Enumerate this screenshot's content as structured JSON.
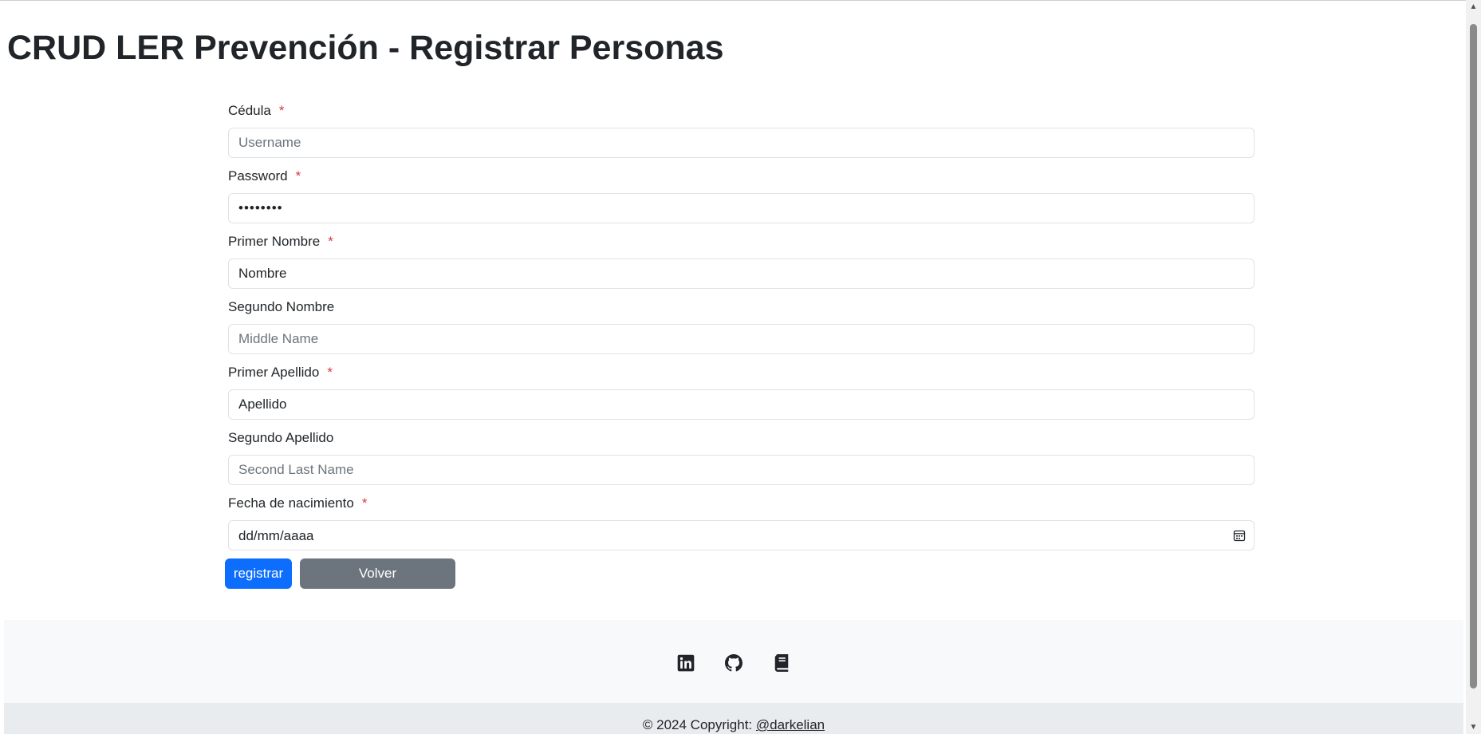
{
  "page": {
    "title": "CRUD LER Prevención - Registrar Personas"
  },
  "form": {
    "required_mark": "*",
    "cedula": {
      "label": "Cédula",
      "placeholder": "Username",
      "value": ""
    },
    "password": {
      "label": "Password",
      "value": "••••••••"
    },
    "primer_nombre": {
      "label": "Primer Nombre",
      "value": "Nombre"
    },
    "segundo_nombre": {
      "label": "Segundo Nombre",
      "placeholder": "Middle Name",
      "value": ""
    },
    "primer_apellido": {
      "label": "Primer Apellido",
      "value": "Apellido"
    },
    "segundo_apellido": {
      "label": "Segundo Apellido",
      "placeholder": "Second Last Name",
      "value": ""
    },
    "fecha_nacimiento": {
      "label": "Fecha de nacimiento",
      "display": "dd/mm/aaaa",
      "icon": "calendar-icon"
    },
    "submit_label": "registrar",
    "back_label": "Volver"
  },
  "footer": {
    "social_icons": [
      "linkedin-icon",
      "github-icon",
      "book-icon"
    ],
    "copyright_prefix": "© 2024 Copyright: ",
    "author_link": "@darkelian"
  },
  "colors": {
    "primary": "#0d6efd",
    "secondary": "#6c757d",
    "required": "#dc3545",
    "footer_light": "#f8f9fa",
    "footer_dark": "#e9ecef"
  }
}
